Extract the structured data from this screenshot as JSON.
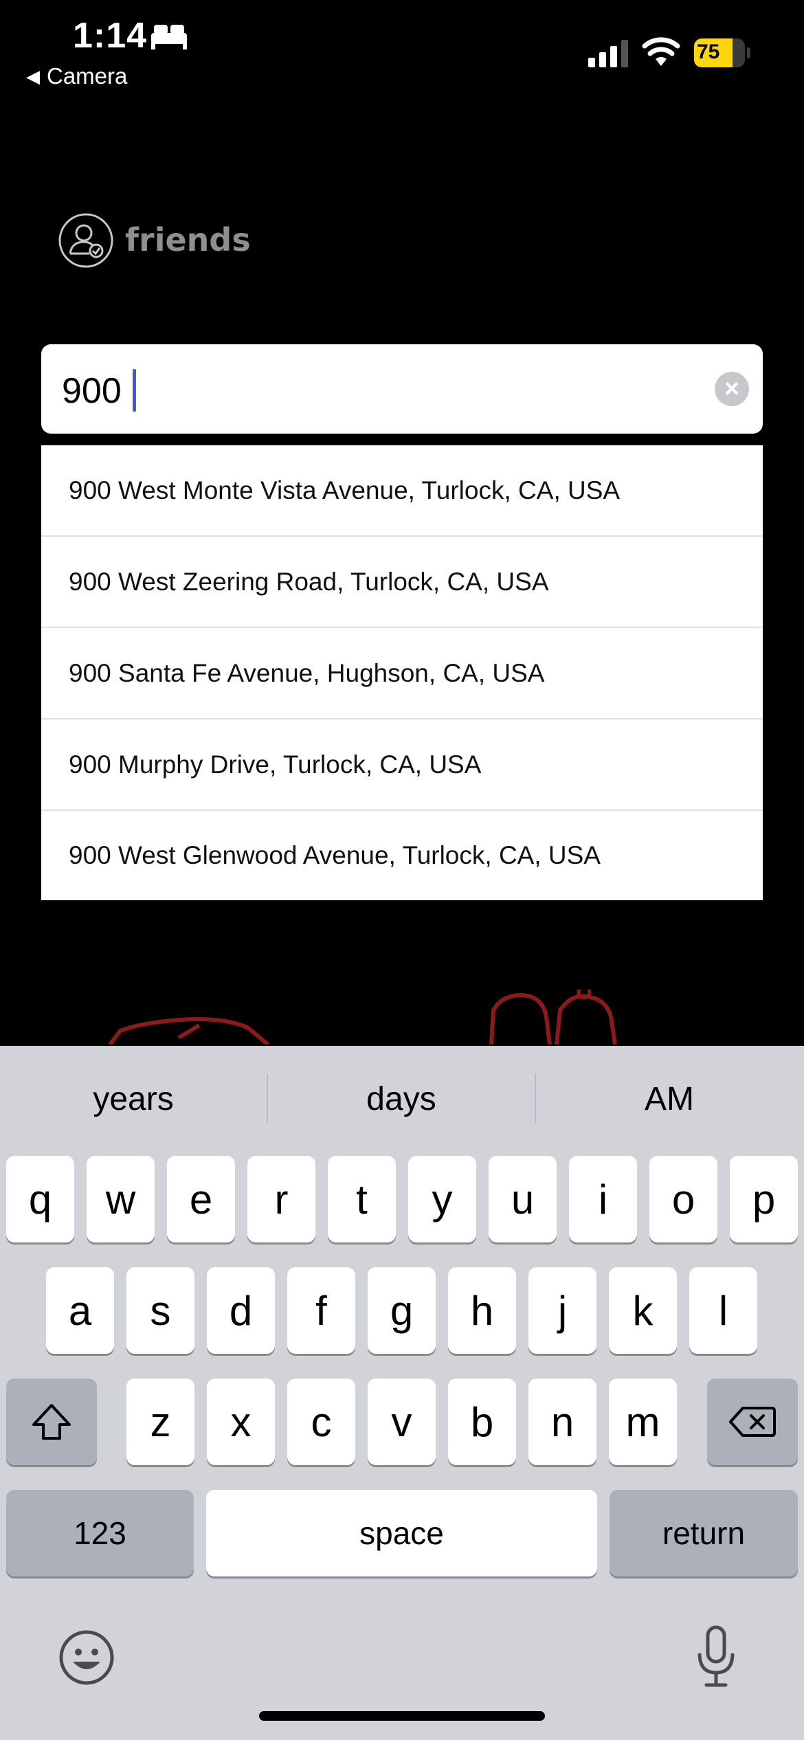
{
  "status_bar": {
    "time": "1:14",
    "back_app": "Camera",
    "battery": "75",
    "icons": [
      "bed-icon",
      "cellular-signal-icon",
      "wifi-icon",
      "battery-charging-icon"
    ]
  },
  "logo": {
    "text": "friends",
    "icon": "friend-verified-icon"
  },
  "search": {
    "value": "900",
    "clear_icon": "clear-icon"
  },
  "suggestions": [
    "900 West Monte Vista Avenue, Turlock, CA, USA",
    "900 West Zeering Road, Turlock, CA, USA",
    "900 Santa Fe Avenue, Hughson, CA, USA",
    "900 Murphy Drive, Turlock, CA, USA",
    "900 West Glenwood Avenue, Turlock, CA, USA"
  ],
  "keyboard": {
    "predictions": [
      "years",
      "days",
      "AM"
    ],
    "row1": [
      "q",
      "w",
      "e",
      "r",
      "t",
      "y",
      "u",
      "i",
      "o",
      "p"
    ],
    "row2": [
      "a",
      "s",
      "d",
      "f",
      "g",
      "h",
      "j",
      "k",
      "l"
    ],
    "row3": [
      "z",
      "x",
      "c",
      "v",
      "b",
      "n",
      "m"
    ],
    "numbers_key": "123",
    "space_key": "space",
    "return_key": "return",
    "icons": [
      "shift-icon",
      "delete-icon",
      "emoji-icon",
      "microphone-icon"
    ]
  },
  "colors": {
    "caret": "#3b5bdb",
    "battery": "#ffd60a",
    "illustration": "#8b1a1a"
  }
}
